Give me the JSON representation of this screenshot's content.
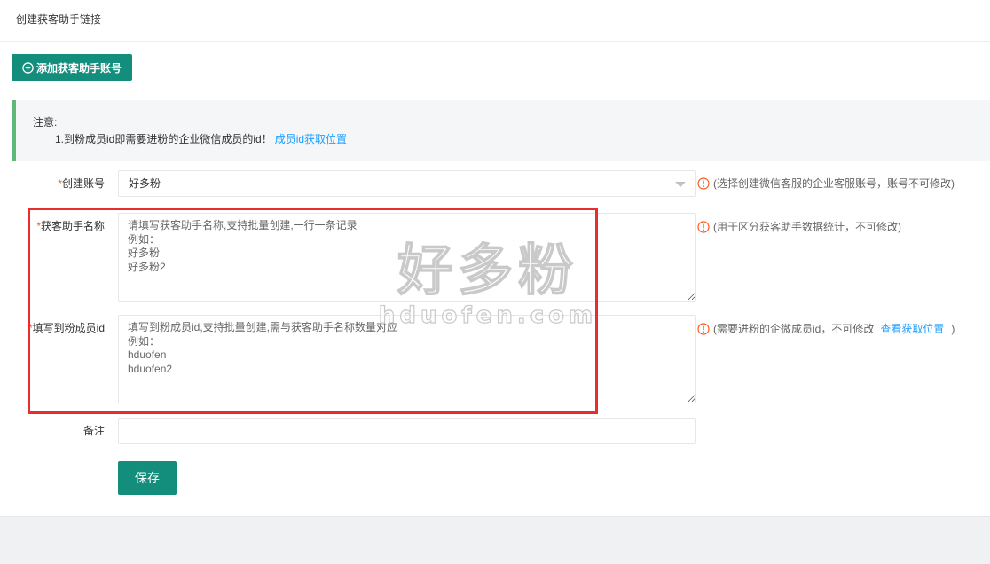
{
  "header": {
    "title": "创建获客助手链接"
  },
  "toolbar": {
    "add_label": "添加获客助手账号"
  },
  "notice": {
    "title": "注意:",
    "line": "1.到粉成员id即需要进粉的企业微信成员的id！",
    "link": "成员id获取位置"
  },
  "form": {
    "account": {
      "required_mark": "*",
      "label": "创建账号",
      "value": "好多粉",
      "hint": "(选择创建微信客服的企业客服账号，账号不可修改)"
    },
    "assistant_name": {
      "required_mark": "*",
      "label": "获客助手名称",
      "placeholder": "请填写获客助手名称,支持批量创建,一行一条记录\n例如：\n好多粉\n好多粉2",
      "hint": "(用于区分获客助手数据统计，不可修改)"
    },
    "member_id": {
      "required_mark": "*",
      "label": "填写到粉成员id",
      "placeholder": "填写到粉成员id,支持批量创建,需与获客助手名称数量对应\n例如：\nhduofen\nhduofen2",
      "hint": "(需要进粉的企微成员id，不可修改",
      "hint_link": "查看获取位置",
      "hint_suffix": ")"
    },
    "remark": {
      "label": "备注",
      "value": ""
    },
    "save_label": "保存"
  },
  "watermark": {
    "cn": "好多粉",
    "domain": "hduofen.com"
  },
  "colors": {
    "primary": "#138e7d",
    "link": "#1e9fff",
    "required": "#ff5722",
    "notice_border": "#5fb878",
    "highlight": "#e62e2e"
  }
}
